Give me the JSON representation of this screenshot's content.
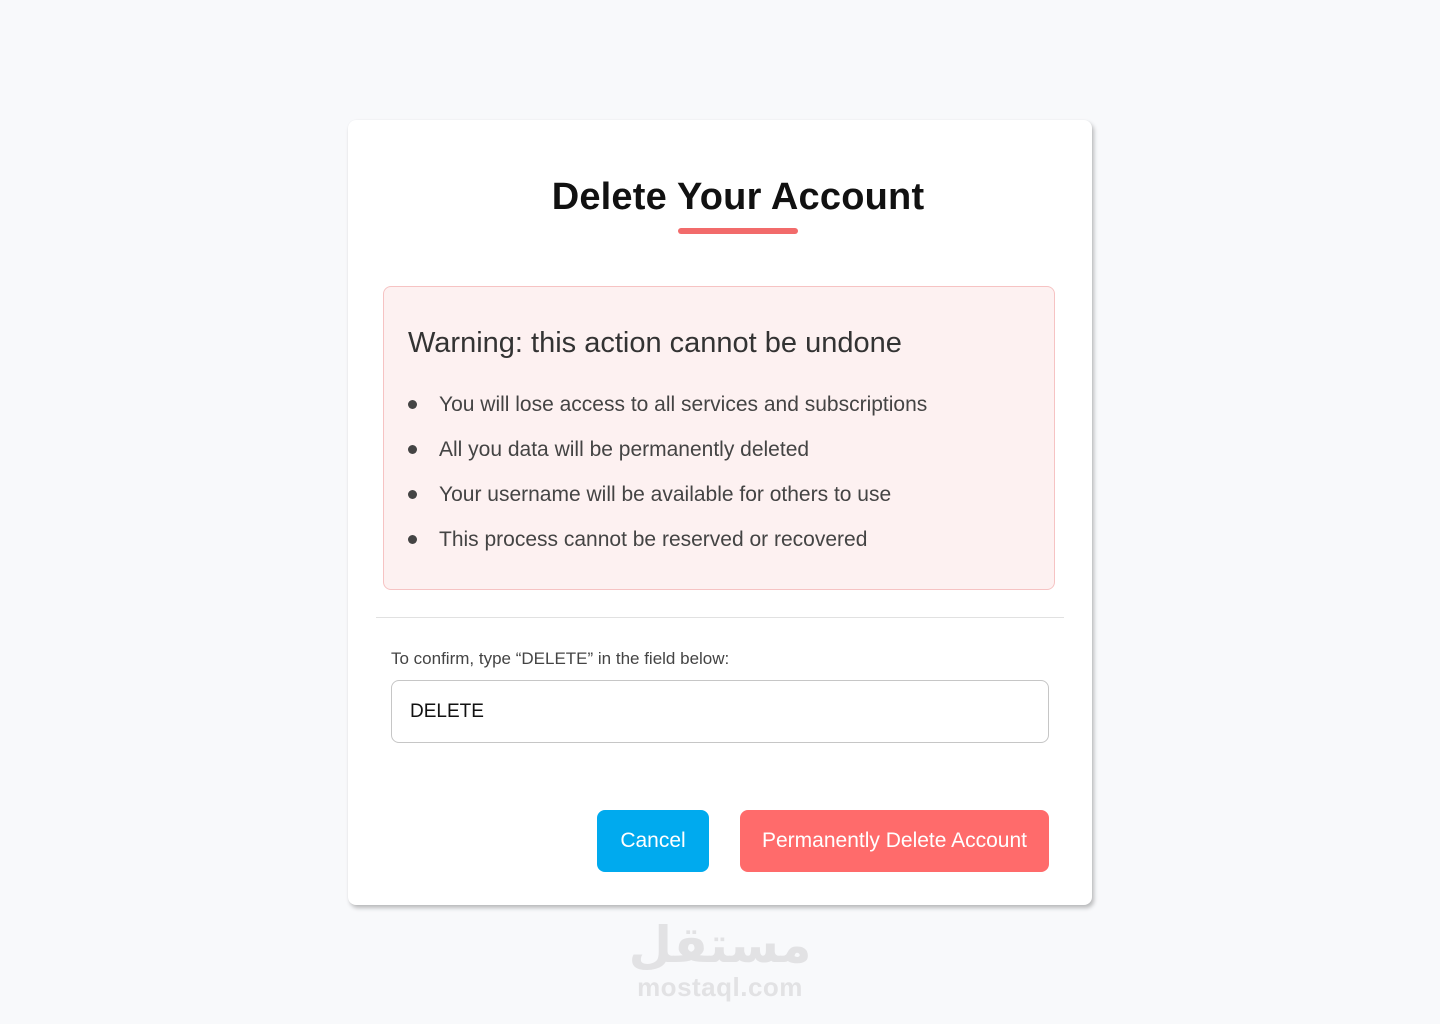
{
  "dialog": {
    "title": "Delete Your Account",
    "warning": {
      "title": "Warning: this action cannot be undone",
      "items": [
        "You will lose access to all services and subscriptions",
        "All you data will be permanently deleted",
        "Your username will be available for others to use",
        "This process cannot be reserved or recovered"
      ]
    },
    "confirm": {
      "label": "To confirm, type “DELETE” in the field below:",
      "value": "DELETE"
    },
    "buttons": {
      "cancel": "Cancel",
      "delete": "Permanently Delete Account"
    }
  },
  "watermark": {
    "logo": "مستقل",
    "domain": "mostaql.com"
  },
  "colors": {
    "accent_red": "#ff6b6b",
    "cancel_blue": "#00aaee",
    "warning_bg": "#fdf1f1",
    "warning_border": "#f6c3c3"
  }
}
